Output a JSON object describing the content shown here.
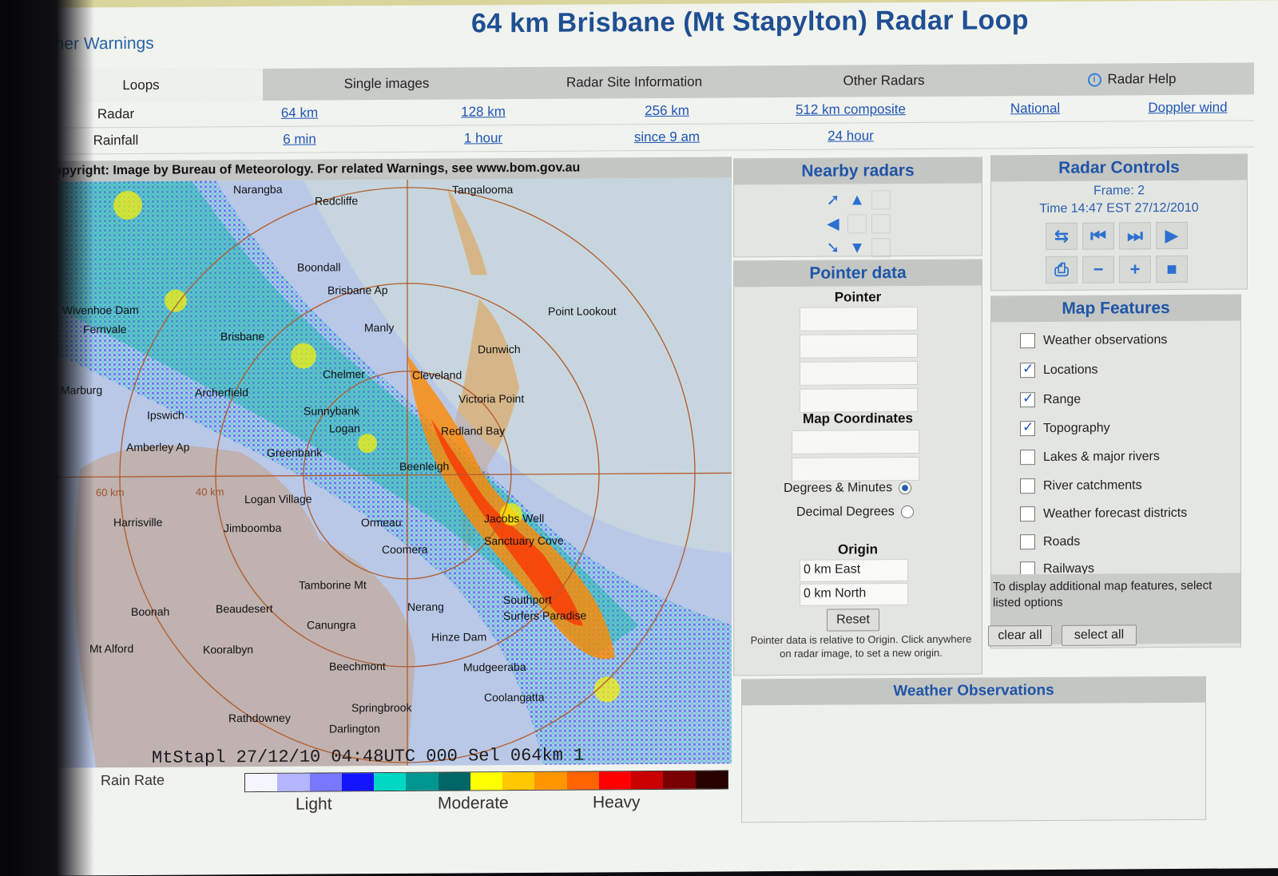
{
  "header": {
    "warnings_link": "Weather Warnings",
    "title": "64 km Brisbane (Mt Stapylton) Radar Loop"
  },
  "tabs": [
    {
      "label": "Loops",
      "active": true
    },
    {
      "label": "Single images",
      "active": false
    },
    {
      "label": "Radar Site Information",
      "active": false
    },
    {
      "label": "Other Radars",
      "active": false
    },
    {
      "label": "Radar Help",
      "active": false,
      "icon": "info-icon"
    }
  ],
  "link_rows": [
    {
      "label": "Radar",
      "links": [
        "64 km",
        "128 km",
        "256 km",
        "512 km composite",
        "National",
        "Doppler wind"
      ]
    },
    {
      "label": "Rainfall",
      "links": [
        "6 min",
        "1 hour",
        "since 9 am",
        "24 hour"
      ]
    }
  ],
  "radar": {
    "copyright": "Copyright: Image by Bureau of Meteorology. For related Warnings, see www.bom.gov.au",
    "footer": "MtStapl 27/12/10 04:48UTC 000 Sel 064km 1",
    "range_labels": [
      "60 km",
      "40 km"
    ],
    "places": [
      "Narangba",
      "Redcliffe",
      "Tangalooma",
      "Boondall",
      "Brisbane Ap",
      "Point Lookout",
      "Wivenhoe Dam",
      "Fernvale",
      "Brisbane",
      "Manly",
      "Dunwich",
      "Cleveland",
      "Chelmer",
      "Victoria Point",
      "Marburg",
      "Archerfield",
      "Sunnybank",
      "Redland Bay",
      "Ipswich",
      "Amberley Ap",
      "Logan",
      "Greenbank",
      "Beenleigh",
      "Harrisville",
      "Logan Village",
      "Jimboomba",
      "Ormeau",
      "Jacobs Well",
      "Sanctuary Cove",
      "Coomera",
      "Tamborine Mt",
      "Boonah",
      "Beaudesert",
      "Nerang",
      "Southport",
      "Surfers Paradise",
      "Canungra",
      "Mt Alford",
      "Kooralbyn",
      "Hinze Dam",
      "Mudgeeraba",
      "Beechmont",
      "Coolangatta",
      "Springbrook",
      "Rathdowney",
      "Darlington"
    ],
    "legend_title": "Rain Rate",
    "legend_words": [
      "Light",
      "Moderate",
      "Heavy"
    ],
    "legend_colors": [
      "#f5f5ff",
      "#b4b4ff",
      "#7878ff",
      "#1414ff",
      "#00d8c3",
      "#009690",
      "#006666",
      "#ffff00",
      "#ffc800",
      "#ff9600",
      "#ff6400",
      "#ff0000",
      "#c80000",
      "#780000",
      "#280000"
    ]
  },
  "nearby": {
    "title": "Nearby radars",
    "arrows": [
      "arrow-northwest-icon",
      "arrow-north-icon",
      "arrow-west-icon",
      "arrow-southwest-icon",
      "arrow-south-icon"
    ]
  },
  "pointer": {
    "title": "Pointer data",
    "pointer_label": "Pointer",
    "map_coords_label": "Map Coordinates",
    "radio_degrees": "Degrees & Minutes",
    "radio_decimal": "Decimal Degrees",
    "origin_label": "Origin",
    "origin_east": "0 km East",
    "origin_north": "0 km North",
    "reset": "Reset",
    "note": "Pointer data is relative to Origin. Click anywhere on radar image, to set a new origin."
  },
  "controls": {
    "title": "Radar Controls",
    "frame": "Frame: 2",
    "time": "Time 14:47 EST 27/12/2010",
    "buttons_row1": [
      "loop-toggle-icon",
      "first-frame-icon",
      "last-frame-icon",
      "play-icon"
    ],
    "buttons_row2": [
      "print-icon",
      "slower-icon",
      "faster-icon",
      "stop-icon"
    ]
  },
  "features": {
    "title": "Map Features",
    "items": [
      {
        "label": "Weather observations",
        "checked": false
      },
      {
        "label": "Locations",
        "checked": true
      },
      {
        "label": "Range",
        "checked": true
      },
      {
        "label": "Topography",
        "checked": true
      },
      {
        "label": "Lakes & major rivers",
        "checked": false
      },
      {
        "label": "River catchments",
        "checked": false
      },
      {
        "label": "Weather forecast districts",
        "checked": false
      },
      {
        "label": "Roads",
        "checked": false
      },
      {
        "label": "Railways",
        "checked": false
      }
    ],
    "note": "To display additional map features, select listed options",
    "clear_all": "clear all",
    "select_all": "select all"
  },
  "observations": {
    "title": "Weather Observations"
  }
}
